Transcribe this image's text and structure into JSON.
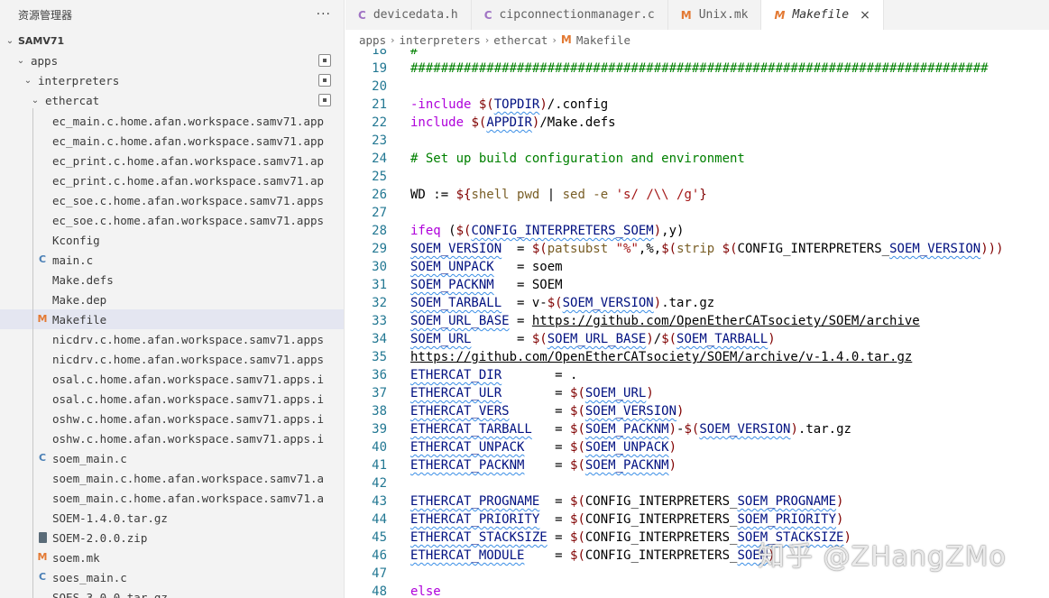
{
  "explorer": {
    "title": "资源管理器",
    "more_icon": "ellipsis-icon",
    "more_glyph": "···",
    "root": "SAMV71",
    "folders": [
      "apps",
      "interpreters",
      "ethercat"
    ],
    "files": [
      {
        "name": "ec_main.c.home.afan.workspace.samv71.app",
        "icon": "file"
      },
      {
        "name": "ec_main.c.home.afan.workspace.samv71.app",
        "icon": "file"
      },
      {
        "name": "ec_print.c.home.afan.workspace.samv71.ap",
        "icon": "file"
      },
      {
        "name": "ec_print.c.home.afan.workspace.samv71.ap",
        "icon": "file"
      },
      {
        "name": "ec_soe.c.home.afan.workspace.samv71.apps",
        "icon": "file"
      },
      {
        "name": "ec_soe.c.home.afan.workspace.samv71.apps",
        "icon": "file"
      },
      {
        "name": "Kconfig",
        "icon": "file"
      },
      {
        "name": "main.c",
        "icon": "c"
      },
      {
        "name": "Make.defs",
        "icon": "file"
      },
      {
        "name": "Make.dep",
        "icon": "file"
      },
      {
        "name": "Makefile",
        "icon": "m",
        "selected": true
      },
      {
        "name": "nicdrv.c.home.afan.workspace.samv71.apps",
        "icon": "file"
      },
      {
        "name": "nicdrv.c.home.afan.workspace.samv71.apps",
        "icon": "file"
      },
      {
        "name": "osal.c.home.afan.workspace.samv71.apps.i",
        "icon": "file"
      },
      {
        "name": "osal.c.home.afan.workspace.samv71.apps.i",
        "icon": "file"
      },
      {
        "name": "oshw.c.home.afan.workspace.samv71.apps.i",
        "icon": "file"
      },
      {
        "name": "oshw.c.home.afan.workspace.samv71.apps.i",
        "icon": "file"
      },
      {
        "name": "soem_main.c",
        "icon": "c"
      },
      {
        "name": "soem_main.c.home.afan.workspace.samv71.a",
        "icon": "file"
      },
      {
        "name": "soem_main.c.home.afan.workspace.samv71.a",
        "icon": "file"
      },
      {
        "name": "SOEM-1.4.0.tar.gz",
        "icon": "file"
      },
      {
        "name": "SOEM-2.0.0.zip",
        "icon": "zip"
      },
      {
        "name": "soem.mk",
        "icon": "m"
      },
      {
        "name": "soes_main.c",
        "icon": "c"
      },
      {
        "name": "SOES-3.0.0.tar.gz",
        "icon": "file"
      }
    ]
  },
  "tabs": [
    {
      "label": "devicedata.h",
      "icon": "C",
      "type": "c"
    },
    {
      "label": "cipconnectionmanager.c",
      "icon": "C",
      "type": "c"
    },
    {
      "label": "Unix.mk",
      "icon": "M",
      "type": "m"
    },
    {
      "label": "Makefile",
      "icon": "M",
      "type": "m",
      "active": true,
      "close": "×"
    }
  ],
  "breadcrumb": [
    "apps",
    "interpreters",
    "ethercat",
    "Makefile"
  ],
  "editor": {
    "lines": [
      {
        "n": "18",
        "html": "<span class=\"cm\">#</span>"
      },
      {
        "n": "19",
        "html": "<span class=\"cm\">############################################################################</span>"
      },
      {
        "n": "20",
        "html": ""
      },
      {
        "n": "21",
        "html": "<span class=\"kw\">-include</span> <span class=\"dol\">$(</span><span class=\"var\">TOPDIR</span><span class=\"dol\">)</span>/.config"
      },
      {
        "n": "22",
        "html": "<span class=\"kw\">include</span> <span class=\"dol\">$(</span><span class=\"var\">APPDIR</span><span class=\"dol\">)</span>/Make.defs"
      },
      {
        "n": "23",
        "html": ""
      },
      {
        "n": "24",
        "html": "<span class=\"cm\"># Set up build configuration and environment</span>"
      },
      {
        "n": "25",
        "html": ""
      },
      {
        "n": "26",
        "html": "WD := <span class=\"dol\">${</span><span class=\"fn\">shell pwd</span> | <span class=\"fn\">sed -e</span> <span class=\"str\">'s/ /\\\\ /g'</span><span class=\"dol\">}</span>"
      },
      {
        "n": "27",
        "html": ""
      },
      {
        "n": "28",
        "html": "<span class=\"kw\">ifeq</span> (<span class=\"dol\">$(</span><span class=\"var\">CONFIG_INTERPRETERS_SOEM</span><span class=\"dol\">)</span>,y)"
      },
      {
        "n": "29",
        "html": "<span class=\"var\">SOEM_VERSION</span>  = <span class=\"dol\">$(</span><span class=\"fn\">patsubst</span> <span class=\"str\">\"%\"</span>,%,<span class=\"dol\">$(</span><span class=\"fn\">strip</span> <span class=\"dol\">$(</span>CONFIG_INTERPRETERS_<span class=\"var\">SOEM_VERSION</span><span class=\"dol\">)))</span>"
      },
      {
        "n": "30",
        "html": "<span class=\"var\">SOEM_UNPACK</span>   = soem"
      },
      {
        "n": "31",
        "html": "<span class=\"var\">SOEM_PACKNM</span>   = SOEM"
      },
      {
        "n": "32",
        "html": "<span class=\"var\">SOEM_TARBALL</span>  = v-<span class=\"dol\">$(</span><span class=\"var\">SOEM_VERSION</span><span class=\"dol\">)</span>.tar.gz"
      },
      {
        "n": "33",
        "html": "<span class=\"var\">SOEM_URL_BASE</span> = <span class=\"url\">https://github.com/OpenEtherCATsociety/SOEM/archive</span>"
      },
      {
        "n": "34",
        "html": "<span class=\"var\">SOEM_URL</span>      = <span class=\"dol\">$(</span><span class=\"var\">SOEM_URL_BASE</span><span class=\"dol\">)</span>/<span class=\"dol\">$(</span><span class=\"var\">SOEM_TARBALL</span><span class=\"dol\">)</span>"
      },
      {
        "n": "35",
        "html": "<span class=\"url\">https://github.com/OpenEtherCATsociety/SOEM/archive/v-1.4.0.tar.gz</span>"
      },
      {
        "n": "36",
        "html": "<span class=\"var\">ETHERCAT_DIR</span>       = ."
      },
      {
        "n": "37",
        "html": "<span class=\"var\">ETHERCAT_ULR</span>       = <span class=\"dol\">$(</span><span class=\"var\">SOEM_URL</span><span class=\"dol\">)</span>"
      },
      {
        "n": "38",
        "html": "<span class=\"var\">ETHERCAT_VERS</span>      = <span class=\"dol\">$(</span><span class=\"var\">SOEM_VERSION</span><span class=\"dol\">)</span>"
      },
      {
        "n": "39",
        "html": "<span class=\"var\">ETHERCAT_TARBALL</span>   = <span class=\"dol\">$(</span><span class=\"var\">SOEM_PACKNM</span><span class=\"dol\">)</span>-<span class=\"dol\">$(</span><span class=\"var\">SOEM_VERSION</span><span class=\"dol\">)</span>.tar.gz"
      },
      {
        "n": "40",
        "html": "<span class=\"var\">ETHERCAT_UNPACK</span>    = <span class=\"dol\">$(</span><span class=\"var\">SOEM_UNPACK</span><span class=\"dol\">)</span>"
      },
      {
        "n": "41",
        "html": "<span class=\"var\">ETHERCAT_PACKNM</span>    = <span class=\"dol\">$(</span><span class=\"var\">SOEM_PACKNM</span><span class=\"dol\">)</span>"
      },
      {
        "n": "42",
        "html": ""
      },
      {
        "n": "43",
        "html": "<span class=\"var\">ETHERCAT_PROGNAME</span>  = <span class=\"dol\">$(</span>CONFIG_INTERPRETERS_<span class=\"var\">SOEM_PROGNAME</span><span class=\"dol\">)</span>"
      },
      {
        "n": "44",
        "html": "<span class=\"var\">ETHERCAT_PRIORITY</span>  = <span class=\"dol\">$(</span>CONFIG_INTERPRETERS_<span class=\"var\">SOEM_PRIORITY</span><span class=\"dol\">)</span>"
      },
      {
        "n": "45",
        "html": "<span class=\"var\">ETHERCAT_STACKSIZE</span> = <span class=\"dol\">$(</span>CONFIG_INTERPRETERS_<span class=\"var\">SOEM_STACKSIZE</span><span class=\"dol\">)</span>"
      },
      {
        "n": "46",
        "html": "<span class=\"var\">ETHERCAT_MODULE</span>    = <span class=\"dol\">$(</span>CONFIG_INTERPRETERS_<span class=\"var\">SOEM</span><span class=\"dol\">)</span>"
      },
      {
        "n": "47",
        "html": ""
      },
      {
        "n": "48",
        "html": "<span class=\"kw\">else</span>"
      }
    ]
  },
  "watermark": "知乎 @ZHangZMo"
}
